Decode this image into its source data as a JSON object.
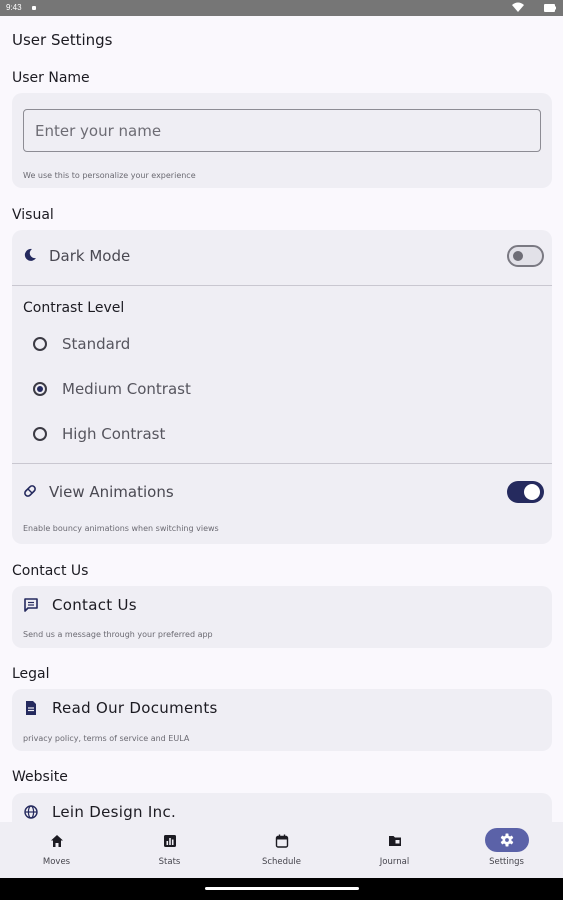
{
  "status_bar": {
    "time": "9:43"
  },
  "page": {
    "title": "User Settings"
  },
  "user_name": {
    "section_title": "User Name",
    "input_placeholder": "Enter your name",
    "input_value": "",
    "helper": "We use this to personalize your experience"
  },
  "visual": {
    "section_title": "Visual",
    "dark_mode": {
      "label": "Dark Mode",
      "enabled": false
    },
    "contrast": {
      "label": "Contrast Level",
      "options": [
        "Standard",
        "Medium Contrast",
        "High Contrast"
      ],
      "selected": "Medium Contrast"
    },
    "animations": {
      "label": "View Animations",
      "enabled": true,
      "helper": "Enable bouncy animations when switching views"
    }
  },
  "contact": {
    "section_title": "Contact Us",
    "title": "Contact Us",
    "helper": "Send us a message through your preferred app"
  },
  "legal": {
    "section_title": "Legal",
    "title": "Read Our Documents",
    "helper": "privacy policy, terms of service and EULA"
  },
  "website": {
    "section_title": "Website",
    "title": "Lein Design Inc."
  },
  "bottom_nav": {
    "items": [
      {
        "label": "Moves",
        "icon": "home-icon"
      },
      {
        "label": "Stats",
        "icon": "bar-chart-icon"
      },
      {
        "label": "Schedule",
        "icon": "calendar-icon"
      },
      {
        "label": "Journal",
        "icon": "folder-icon"
      },
      {
        "label": "Settings",
        "icon": "gear-icon"
      }
    ],
    "active": "Settings"
  },
  "colors": {
    "accent": "#252a5e",
    "active_pill": "#5b62a8",
    "card_bg": "#efeef4",
    "page_bg": "#faf8fd"
  }
}
